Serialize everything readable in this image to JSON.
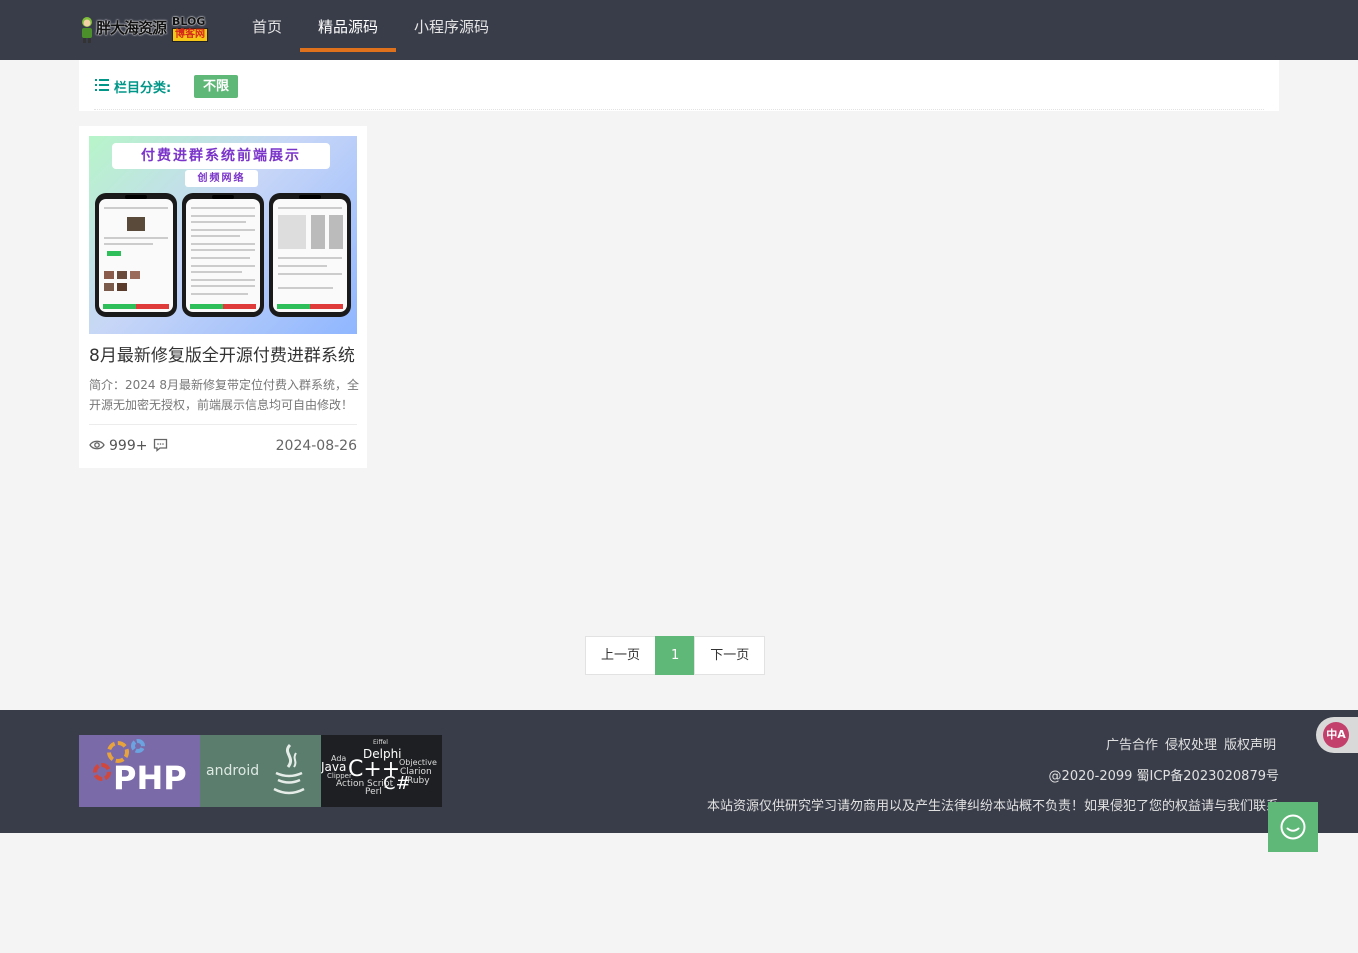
{
  "header": {
    "logo": {
      "cn": "胖大海资源",
      "en": "BLOG",
      "tag": "博客网",
      "url": "www.pdh.cn"
    },
    "nav": [
      {
        "label": "首页",
        "active": false
      },
      {
        "label": "精品源码",
        "active": true
      },
      {
        "label": "小程序源码",
        "active": false
      }
    ]
  },
  "category": {
    "label": "栏目分类:",
    "tag": "不限"
  },
  "cards": [
    {
      "thumb_title": "付费进群系统前端展示",
      "thumb_sub": "创频网络",
      "title": "8月最新修复版全开源付费进群系统",
      "desc": "简介：2024 8月最新修复带定位付费入群系统，全开源无加密无授权，前端展示信息均可自由修改！",
      "views": "999+",
      "date": "2024-08-26"
    }
  ],
  "pager": {
    "prev": "上一页",
    "current": "1",
    "next": "下一页"
  },
  "footer": {
    "logos": {
      "php": "PHP",
      "android": "android"
    },
    "langs": [
      "Delphi",
      "Java",
      "C++",
      "C#",
      "Objective",
      "Clarion",
      "Ada",
      "Ruby",
      "Action Script",
      "Perl",
      "Clipper",
      "Eiffel"
    ],
    "links": [
      "广告合作",
      "侵权处理",
      "版权声明"
    ],
    "copyright": "@2020-2099 蜀ICP备2023020879号",
    "note": "本站资源仅供研究学习请勿商用以及产生法律纠纷本站概不负责！如果侵犯了您的权益请与我们联系"
  },
  "colors": {
    "header_bg": "#393d49",
    "accent_orange": "#e0711c",
    "green": "#5fb878",
    "teal": "#009688"
  },
  "widgets": {
    "translate_label": "中A"
  }
}
